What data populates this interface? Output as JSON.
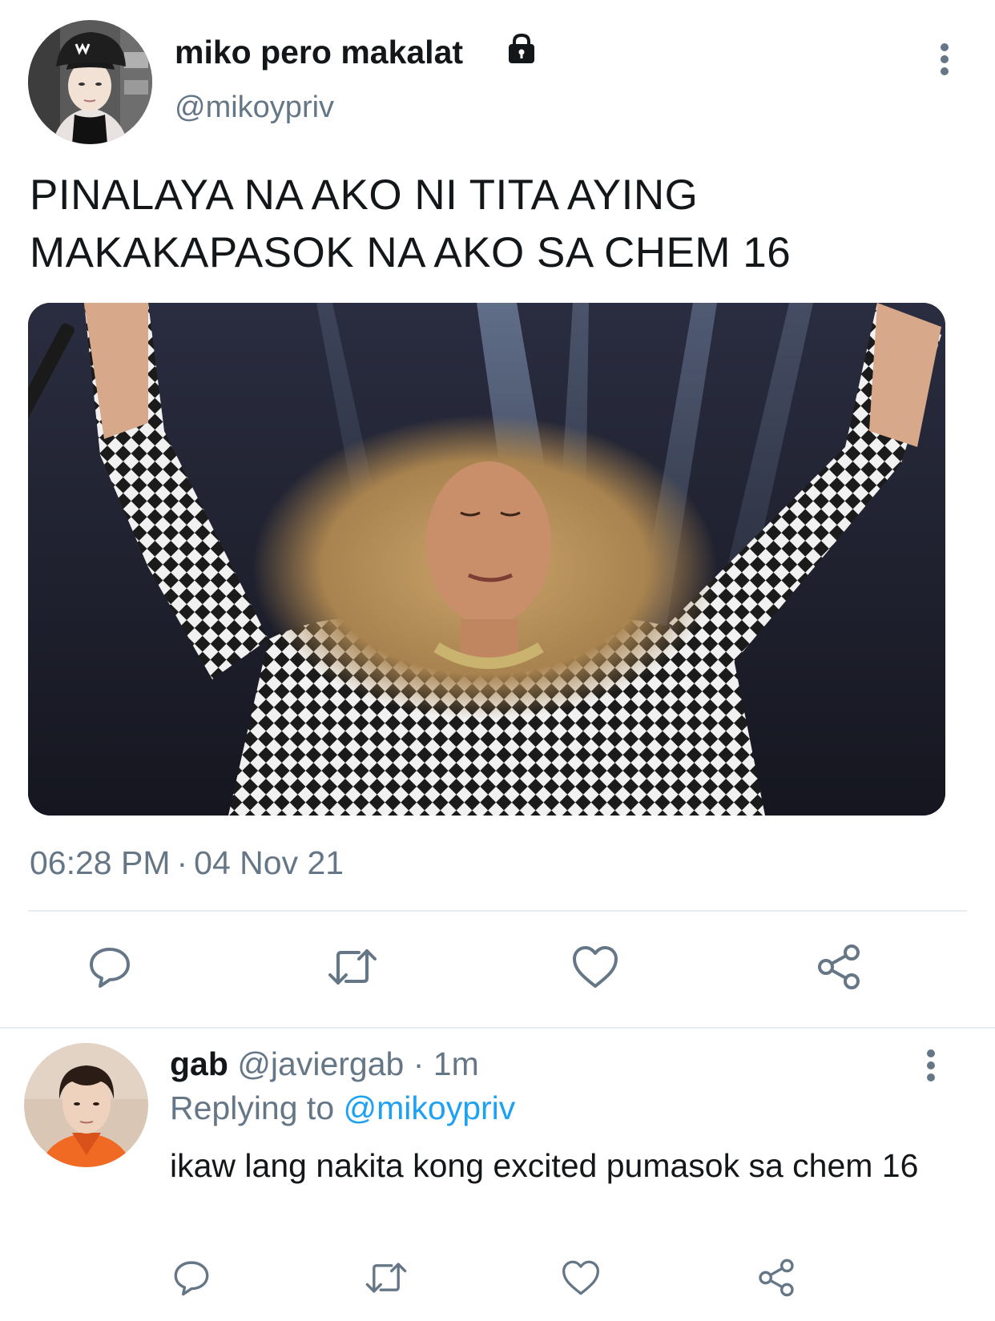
{
  "tweet": {
    "author": {
      "display_name": "miko pero makalat",
      "handle": "@mikoypriv",
      "protected_icon": "lock-icon",
      "avatar_logo": "W"
    },
    "text_line1": "PINALAYA NA AKO NI TITA AYING",
    "text_line2": "MAKAKAPASOK NA AKO SA CHEM 16",
    "time": "06:28 PM",
    "separator": "·",
    "date": "04 Nov 21",
    "actions": [
      "reply-icon",
      "retweet-icon",
      "like-icon",
      "share-icon"
    ]
  },
  "reply": {
    "display_name": "gab",
    "handle": "@javiergab",
    "separator": "·",
    "age": "1m",
    "replying_prefix": "Replying to",
    "replying_to": "@mikoypriv",
    "text": "ikaw lang nakita kong excited pumasok sa chem 16",
    "actions": [
      "reply-icon",
      "retweet-icon",
      "like-icon",
      "share-icon"
    ]
  },
  "colors": {
    "text_primary": "#14171a",
    "text_secondary": "#657786",
    "link": "#1da1f2",
    "icon": "#657786",
    "divider": "#e6ecf0"
  }
}
